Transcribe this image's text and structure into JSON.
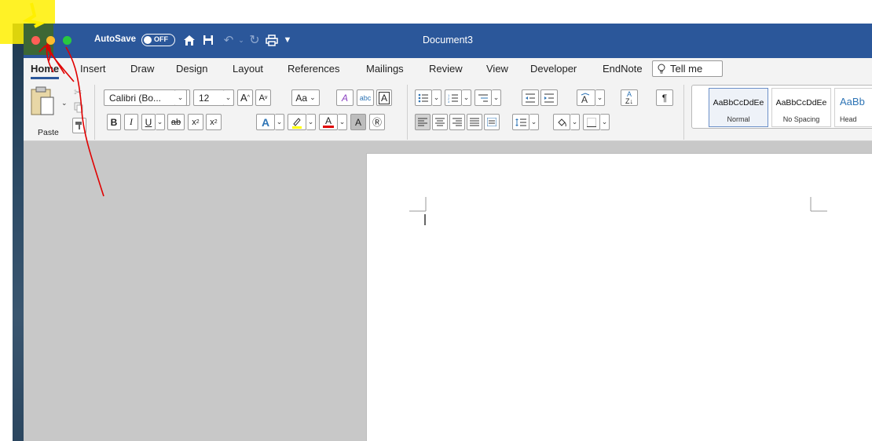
{
  "window": {
    "title": "Document3",
    "autosave_label": "AutoSave",
    "autosave_state": "OFF"
  },
  "tabs": [
    {
      "label": "Home",
      "active": true
    },
    {
      "label": "Insert"
    },
    {
      "label": "Draw"
    },
    {
      "label": "Design"
    },
    {
      "label": "Layout"
    },
    {
      "label": "References"
    },
    {
      "label": "Mailings"
    },
    {
      "label": "Review"
    },
    {
      "label": "View"
    },
    {
      "label": "Developer"
    },
    {
      "label": "EndNote"
    }
  ],
  "tell_me": "Tell me",
  "clipboard": {
    "paste_label": "Paste"
  },
  "font": {
    "family": "Calibri (Bo...",
    "size": "12",
    "case_label": "Aa",
    "bold": "B",
    "italic": "I",
    "underline": "U",
    "strikethrough": "ab",
    "subscript": "x",
    "superscript": "x",
    "highlight_color": "#ffff00",
    "font_color": "#e00000"
  },
  "styles": [
    {
      "sample": "AaBbCcDdEe",
      "name": "Normal",
      "selected": true
    },
    {
      "sample": "AaBbCcDdEe",
      "name": "No Spacing"
    },
    {
      "sample": "AaBb",
      "name": "Head"
    }
  ],
  "colors": {
    "titlebar": "#2b579a",
    "annotation_yellow": "#fff000",
    "annotation_red": "#e00000"
  }
}
